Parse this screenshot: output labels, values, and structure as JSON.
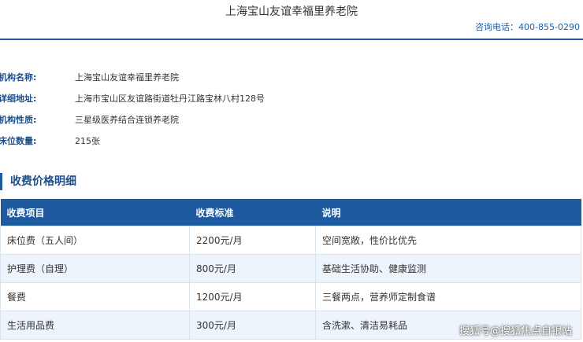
{
  "header": {
    "title": "上海宝山友谊幸福里养老院",
    "hotline": "咨询电话：400-855-0290"
  },
  "info": [
    {
      "label": "机构名称:",
      "value": "上海宝山友谊幸福里养老院"
    },
    {
      "label": "详细地址:",
      "value": "上海市宝山区友谊路街道牡丹江路宝林八村128号"
    },
    {
      "label": "机构性质:",
      "value": "三星级医养结合连锁养老院"
    },
    {
      "label": "床位数量:",
      "value": "215张"
    }
  ],
  "section_title": "收费价格明细",
  "table": {
    "headers": [
      "收费项目",
      "收费标准",
      "说明"
    ],
    "rows": [
      [
        "床位费（五人间）",
        "2200元/月",
        "空间宽敞，性价比优先"
      ],
      [
        "护理费（自理）",
        "800元/月",
        "基础生活协助、健康监测"
      ],
      [
        "餐费",
        "1200元/月",
        "三餐两点，营养师定制食谱"
      ],
      [
        "生活用品费",
        "300元/月",
        "含洗漱、清洁易耗品"
      ]
    ]
  },
  "watermark": "搜狐号@搜狐焦点自银站",
  "colors": {
    "accent": "#1d5aa0",
    "row_alt": "#eef4fb"
  }
}
